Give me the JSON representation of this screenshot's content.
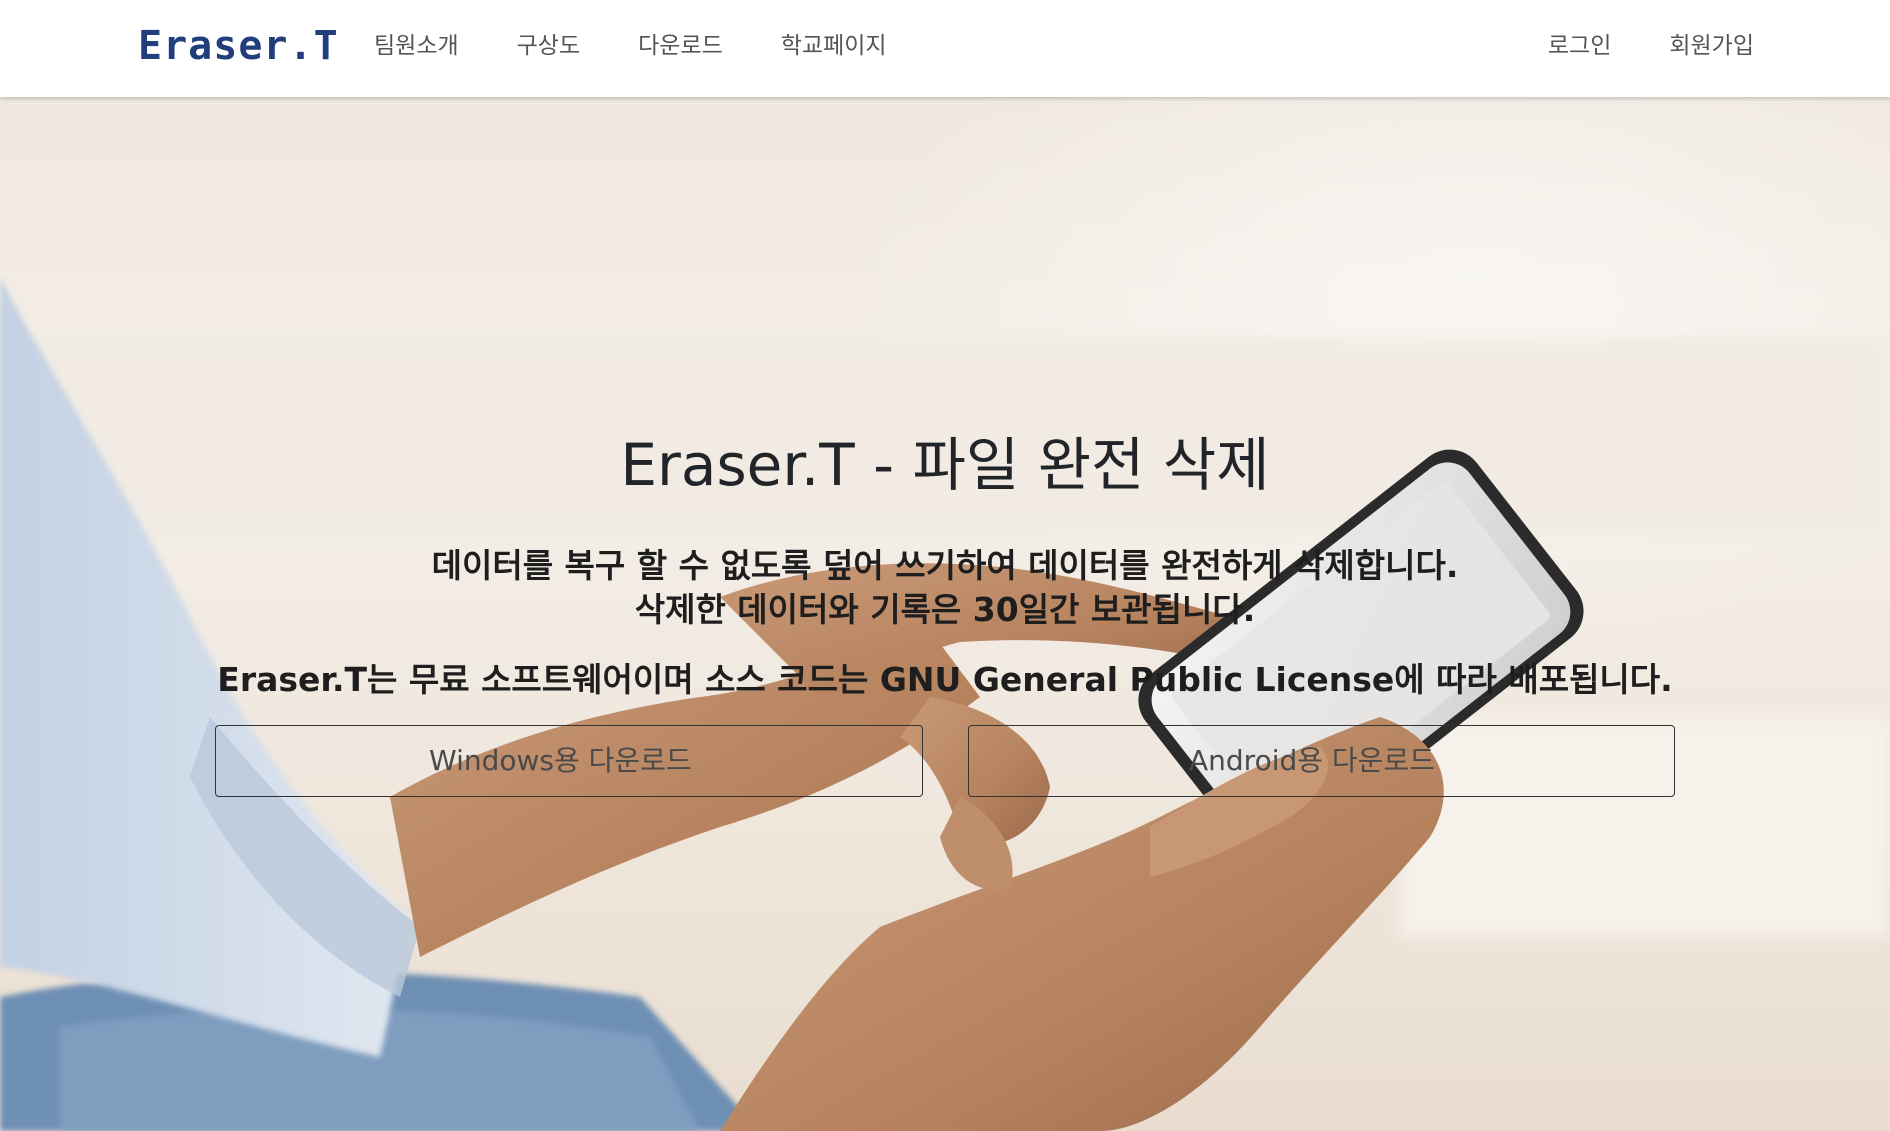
{
  "navbar": {
    "brand": "Eraser.T",
    "left_links": [
      "팀원소개",
      "구상도",
      "다운로드",
      "학교페이지"
    ],
    "right_links": [
      "로그인",
      "회원가입"
    ]
  },
  "hero": {
    "title_brand": "Eraser.T",
    "title_rest": " - 파일 완전 삭제",
    "desc_line1": "데이터를 복구 할 수 없도록 덮어 쓰기하여 데이터를 완전하게 삭제합니다.",
    "desc_line2": "삭제한 데이터와 기록은 30일간 보관됩니다.",
    "license": "Eraser.T는 무료 소프트웨어이며 소스 코드는 GNU General Public License에 따라 배포됩니다.",
    "btn_windows": "Windows용 다운로드",
    "btn_android": "Android용 다운로드"
  },
  "colors": {
    "brand": "#233f7b",
    "nav_text": "#555555",
    "hero_text": "#212529"
  }
}
